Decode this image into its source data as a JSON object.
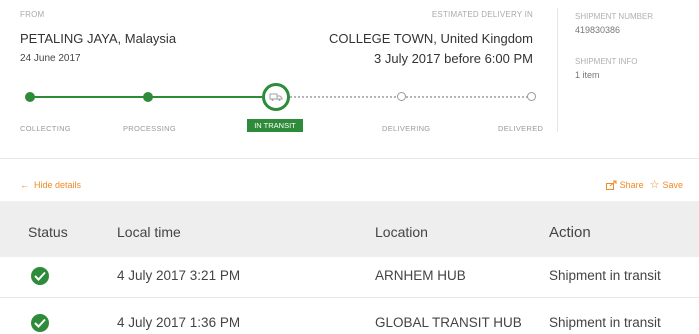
{
  "header": {
    "from_label": "FROM",
    "from_location": "PETALING JAYA, Malaysia",
    "from_date": "24 June 2017",
    "est_label": "ESTIMATED DELIVERY IN",
    "to_location": "COLLEGE TOWN, United Kingdom",
    "est_date": "3 July 2017 before 6:00 PM",
    "shipment_number_label": "SHIPMENT NUMBER",
    "shipment_number": "419830386",
    "shipment_info_label": "SHIPMENT INFO",
    "shipment_info": "1 item"
  },
  "progress": {
    "steps": [
      {
        "label": "COLLECTING",
        "state": "done"
      },
      {
        "label": "PROCESSING",
        "state": "done"
      },
      {
        "label": "IN TRANSIT",
        "state": "current"
      },
      {
        "label": "DELIVERING",
        "state": "future"
      },
      {
        "label": "DELIVERED",
        "state": "future"
      }
    ],
    "current_icon": "truck-icon"
  },
  "actions": {
    "hide_details": "Hide details",
    "share": "Share",
    "save": "Save"
  },
  "table": {
    "headers": {
      "status": "Status",
      "time": "Local time",
      "location": "Location",
      "action": "Action"
    },
    "rows": [
      {
        "status_icon": "check-circle-icon",
        "time": "4 July 2017 3:21 PM",
        "location": "ARNHEM HUB",
        "action": "Shipment in transit"
      },
      {
        "status_icon": "check-circle-icon",
        "time": "4 July 2017 1:36 PM",
        "location": "GLOBAL TRANSIT HUB",
        "action": "Shipment in transit"
      }
    ]
  },
  "colors": {
    "accent_green": "#2e8b3a",
    "accent_orange": "#f08a24"
  }
}
